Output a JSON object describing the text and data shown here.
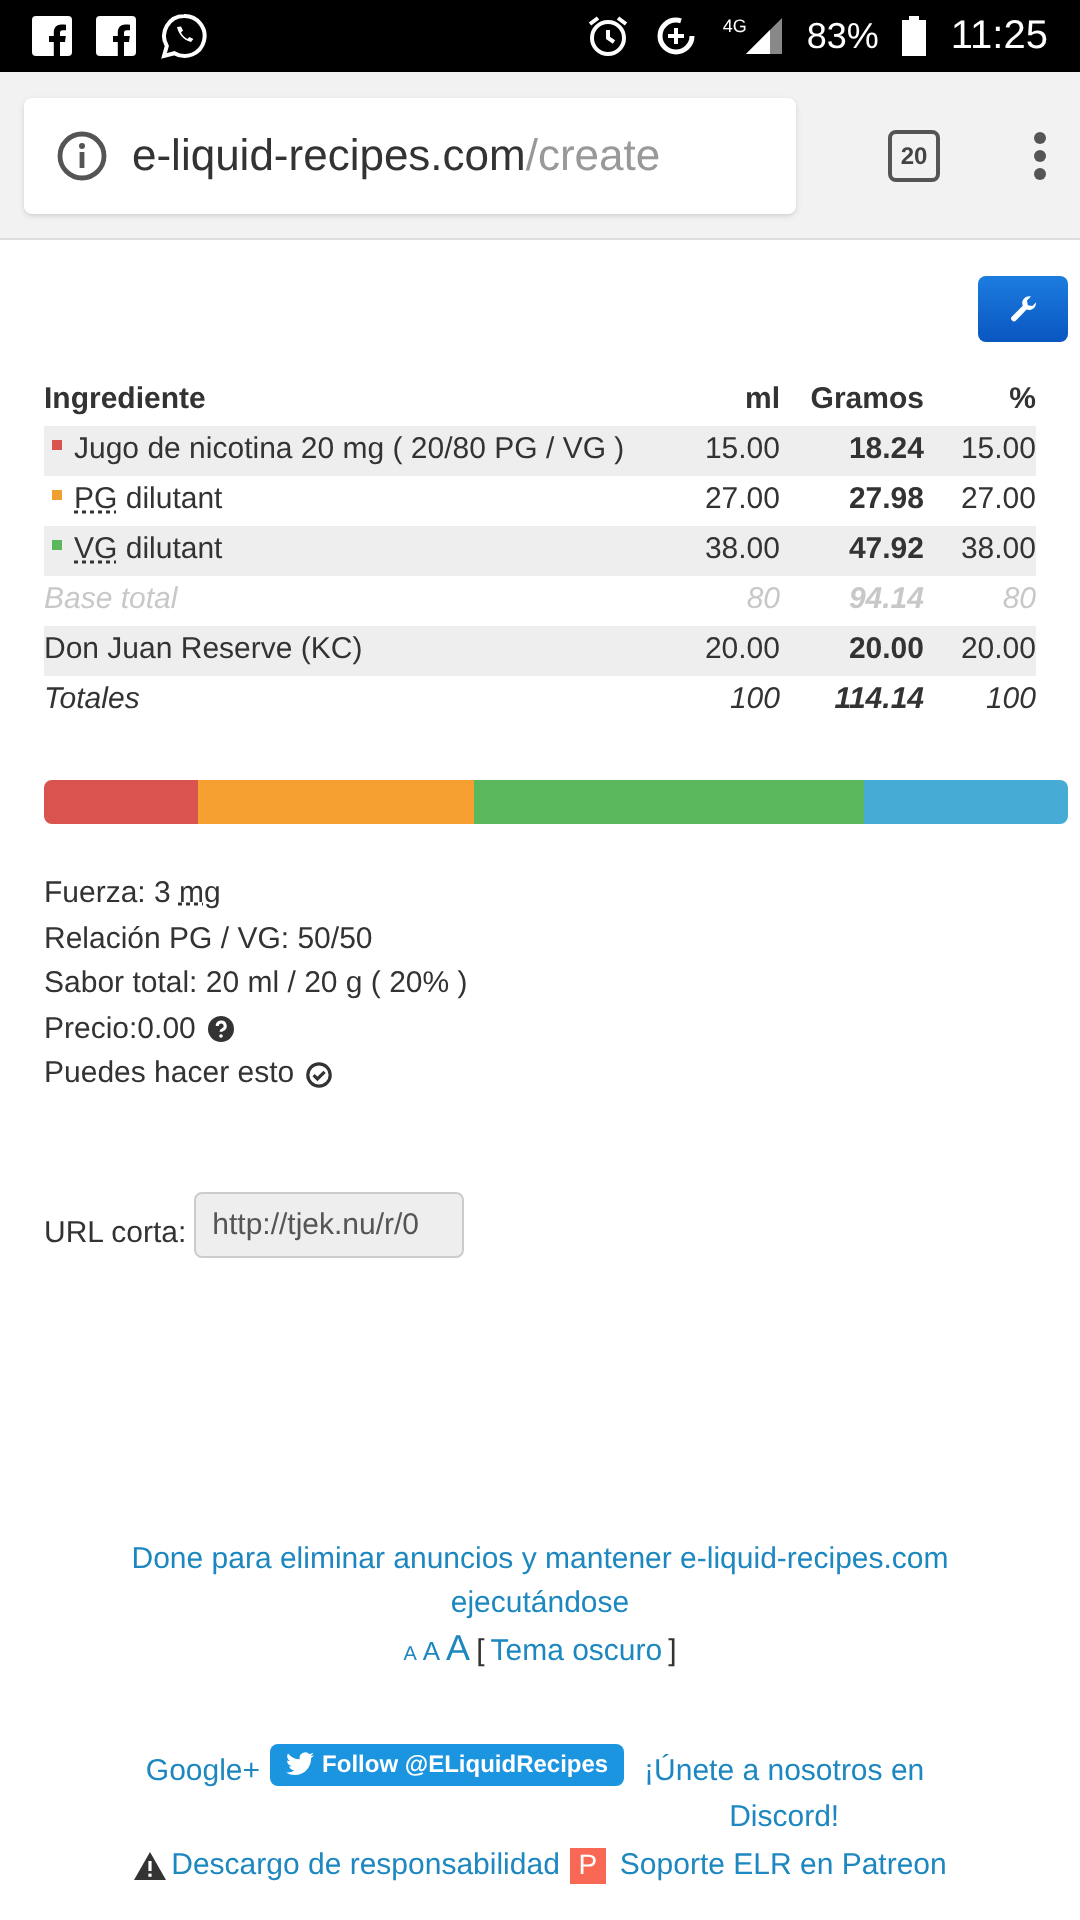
{
  "status_bar": {
    "battery": "83%",
    "time": "11:25",
    "network": "4G"
  },
  "browser": {
    "domain": "e-liquid-recipes.com",
    "path": "/create",
    "tab_count": "20"
  },
  "table": {
    "columns": [
      "Ingrediente",
      "ml",
      "Gramos",
      "%"
    ],
    "rows": [
      {
        "kind": "ingredient",
        "color": "#d9534f",
        "name": "Jugo de nicotina 20 mg ( 20/80 PG / VG )",
        "ml": "15.00",
        "grams": "18.24",
        "percent": "15.00"
      },
      {
        "kind": "ingredient",
        "color": "#f0a030",
        "abbr": "PG",
        "name": " dilutant",
        "ml": "27.00",
        "grams": "27.98",
        "percent": "27.00"
      },
      {
        "kind": "ingredient",
        "color": "#5cb85c",
        "abbr": "VG",
        "name": " dilutant",
        "ml": "38.00",
        "grams": "47.92",
        "percent": "38.00"
      },
      {
        "kind": "base",
        "name": "Base total",
        "ml": "80",
        "grams": "94.14",
        "percent": "80"
      },
      {
        "kind": "flavor",
        "name": "Don Juan Reserve (KC)",
        "ml": "20.00",
        "grams": "20.00",
        "percent": "20.00"
      },
      {
        "kind": "total",
        "name": "Totales",
        "ml": "100",
        "grams": "114.14",
        "percent": "100"
      }
    ]
  },
  "mix_bar": [
    {
      "color": "#d9534f"
    },
    {
      "color": "#f5a030"
    },
    {
      "color": "#5cb85c"
    },
    {
      "color": "#46acd6"
    }
  ],
  "summary": [
    {
      "text": "Fuerza: 3 ",
      "abbr": "mg"
    },
    {
      "text": "Relación PG / VG: 50/50"
    },
    {
      "text": "Sabor total: 20 ml / 20 g ( 20% )"
    },
    {
      "text": "Precio:0.00",
      "kind": "help"
    },
    {
      "text": "Puedes hacer esto",
      "kind": "check"
    }
  ],
  "short_url": {
    "label": "URL corta:",
    "value": "http://tjek.nu/r/0"
  },
  "footer": {
    "donate": "Done para eliminar anuncios y mantener e-liquid-recipes.com ejecutándose",
    "font_sizes": [
      "A",
      "A",
      "A"
    ],
    "open_bracket": "[",
    "theme": "Tema oscuro",
    "close_bracket": "]",
    "google": "Google+",
    "twitter": "Follow @ELiquidRecipes",
    "discord": "¡Únete a nosotros en Discord!",
    "disclaimer": "Descargo de responsabilidad",
    "patreon_icon": "P",
    "patreon": "Soporte ELR en Patreon"
  }
}
